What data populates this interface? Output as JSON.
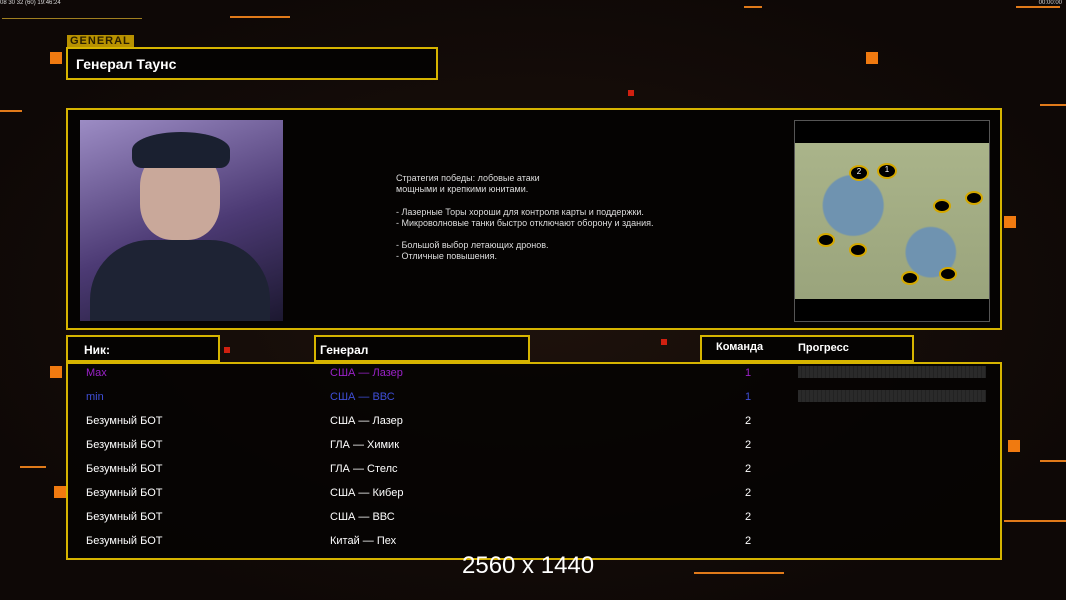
{
  "status_bar": {
    "left": "08 30 32 (60) 19:46:24",
    "right": "00:00:00"
  },
  "logo": "GENERAL",
  "general_name": "Генерал Таунс",
  "description": [
    "Стратегия победы: лобовые атаки",
    "мощными и крепкими юнитами.",
    "",
    "- Лазерные Торы хороши для контроля карты и поддержки.",
    "- Микроволновые танки быстро отключают оборону и здания.",
    "",
    "- Большой выбор летающих дронов.",
    "- Отличные повышения."
  ],
  "headers": {
    "nick": "Ник:",
    "general": "Генерал",
    "team": "Команда",
    "progress": "Прогресс"
  },
  "players": [
    {
      "nick": "Max",
      "general": "США — Лазер",
      "team": "1",
      "color": "#9a22c8",
      "progress": 0
    },
    {
      "nick": "min",
      "general": "США — ВВС",
      "team": "1",
      "color": "#3f4fd8",
      "progress": 0
    },
    {
      "nick": "Безумный БОТ",
      "general": "США — Лазер",
      "team": "2",
      "color": "#ffffff"
    },
    {
      "nick": "Безумный БОТ",
      "general": "ГЛА — Химик",
      "team": "2",
      "color": "#ffffff"
    },
    {
      "nick": "Безумный БОТ",
      "general": "ГЛА — Стелс",
      "team": "2",
      "color": "#ffffff"
    },
    {
      "nick": "Безумный БОТ",
      "general": "США — Кибер",
      "team": "2",
      "color": "#ffffff"
    },
    {
      "nick": "Безумный БОТ",
      "general": "США — ВВС",
      "team": "2",
      "color": "#ffffff"
    },
    {
      "nick": "Безумный БОТ",
      "general": "Китай — Пех",
      "team": "2",
      "color": "#ffffff"
    }
  ],
  "map_markers": [
    "2",
    "1"
  ],
  "resolution": "2560 x 1440"
}
